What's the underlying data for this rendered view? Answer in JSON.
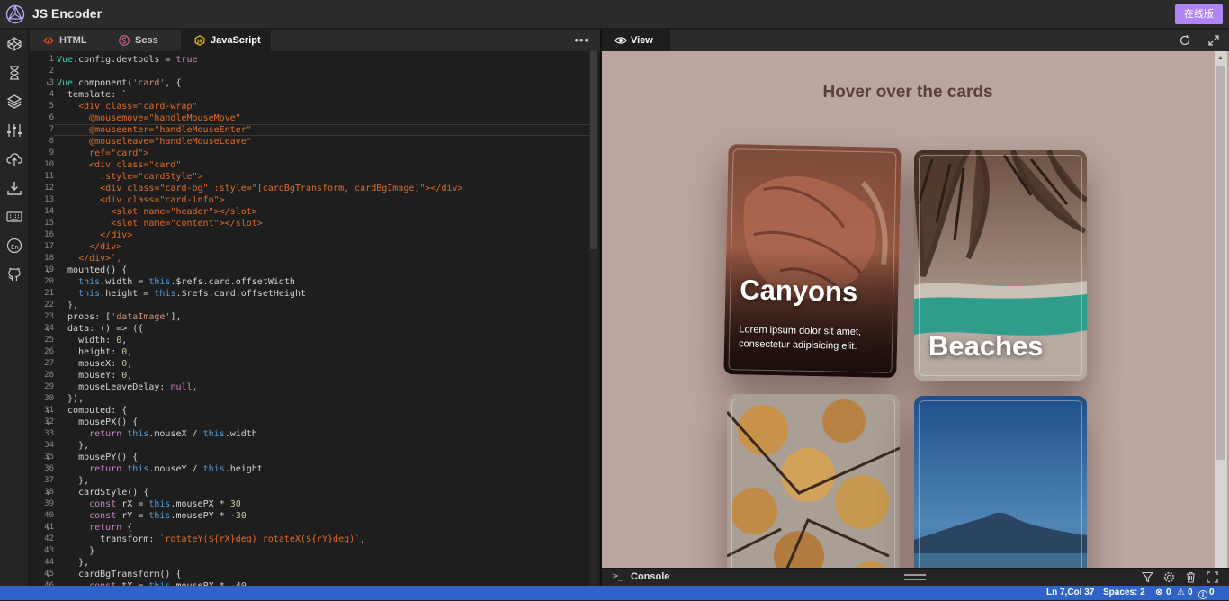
{
  "app": {
    "title": "JS Encoder",
    "online_button": "在线版"
  },
  "sidebar": {
    "icons": [
      "codepen-icon",
      "hourglass-icon",
      "layers-icon",
      "sliders-icon",
      "cloud-upload-icon",
      "download-icon",
      "keyboard-icon",
      "language-icon",
      "github-icon"
    ]
  },
  "editor": {
    "tabs": [
      {
        "label": "HTML",
        "icon": "html-icon",
        "color": "#e44d26"
      },
      {
        "label": "Scss",
        "icon": "sass-icon",
        "color": "#cd6799"
      },
      {
        "label": "JavaScript",
        "icon": "javascript-icon",
        "color": "#f0c020"
      }
    ],
    "more": "•••",
    "lines": [
      {
        "n": "1",
        "f": "",
        "t": "Vue.config.devtools = true"
      },
      {
        "n": "2",
        "f": "",
        "t": ""
      },
      {
        "n": "3",
        "f": "∨",
        "t": "Vue.component('card', {"
      },
      {
        "n": "4",
        "f": "",
        "t": "  template: `"
      },
      {
        "n": "5",
        "f": "",
        "t": "    <div class=\"card-wrap\""
      },
      {
        "n": "6",
        "f": "",
        "t": "      @mousemove=\"handleMouseMove\""
      },
      {
        "n": "7",
        "f": "",
        "t": "      @mouseenter=\"handleMouseEnter\""
      },
      {
        "n": "8",
        "f": "",
        "t": "      @mouseleave=\"handleMouseLeave\""
      },
      {
        "n": "9",
        "f": "",
        "t": "      ref=\"card\">"
      },
      {
        "n": "10",
        "f": "",
        "t": "      <div class=\"card\""
      },
      {
        "n": "11",
        "f": "",
        "t": "        :style=\"cardStyle\">"
      },
      {
        "n": "12",
        "f": "",
        "t": "        <div class=\"card-bg\" :style=\"[cardBgTransform, cardBgImage]\"></div>"
      },
      {
        "n": "13",
        "f": "",
        "t": "        <div class=\"card-info\">"
      },
      {
        "n": "14",
        "f": "",
        "t": "          <slot name=\"header\"></slot>"
      },
      {
        "n": "15",
        "f": "",
        "t": "          <slot name=\"content\"></slot>"
      },
      {
        "n": "16",
        "f": "",
        "t": "        </div>"
      },
      {
        "n": "17",
        "f": "",
        "t": "      </div>"
      },
      {
        "n": "18",
        "f": "",
        "t": "    </div>`,"
      },
      {
        "n": "19",
        "f": "∨",
        "t": "  mounted() {"
      },
      {
        "n": "20",
        "f": "",
        "t": "    this.width = this.$refs.card.offsetWidth"
      },
      {
        "n": "21",
        "f": "",
        "t": "    this.height = this.$refs.card.offsetHeight"
      },
      {
        "n": "22",
        "f": "",
        "t": "  },"
      },
      {
        "n": "23",
        "f": "",
        "t": "  props: ['dataImage'],"
      },
      {
        "n": "24",
        "f": "∨",
        "t": "  data: () => ({"
      },
      {
        "n": "25",
        "f": "",
        "t": "    width: 0,"
      },
      {
        "n": "26",
        "f": "",
        "t": "    height: 0,"
      },
      {
        "n": "27",
        "f": "",
        "t": "    mouseX: 0,"
      },
      {
        "n": "28",
        "f": "",
        "t": "    mouseY: 0,"
      },
      {
        "n": "29",
        "f": "",
        "t": "    mouseLeaveDelay: null,"
      },
      {
        "n": "30",
        "f": "",
        "t": "  }),"
      },
      {
        "n": "31",
        "f": "∨",
        "t": "  computed: {"
      },
      {
        "n": "32",
        "f": "∨",
        "t": "    mousePX() {"
      },
      {
        "n": "33",
        "f": "",
        "t": "      return this.mouseX / this.width"
      },
      {
        "n": "34",
        "f": "",
        "t": "    },"
      },
      {
        "n": "35",
        "f": "∨",
        "t": "    mousePY() {"
      },
      {
        "n": "36",
        "f": "",
        "t": "      return this.mouseY / this.height"
      },
      {
        "n": "37",
        "f": "",
        "t": "    },"
      },
      {
        "n": "38",
        "f": "∨",
        "t": "    cardStyle() {"
      },
      {
        "n": "39",
        "f": "",
        "t": "      const rX = this.mousePX * 30"
      },
      {
        "n": "40",
        "f": "",
        "t": "      const rY = this.mousePY * -30"
      },
      {
        "n": "41",
        "f": "∨",
        "t": "      return {"
      },
      {
        "n": "42",
        "f": "",
        "t": "        transform: `rotateY(${rX}deg) rotateX(${rY}deg)`,"
      },
      {
        "n": "43",
        "f": "",
        "t": "      }"
      },
      {
        "n": "44",
        "f": "",
        "t": "    },"
      },
      {
        "n": "45",
        "f": "∨",
        "t": "    cardBgTransform() {"
      },
      {
        "n": "46",
        "f": "",
        "t": "      const tX = this.mousePX * -40"
      }
    ],
    "line_colors": {
      "template": "#e06c2a",
      "default": "#d4d4d4",
      "teal": "#4ec9b0",
      "blue": "#569cd6",
      "string": "#ce9178",
      "number": "#b5cea8",
      "keyword": "#c586c0",
      "prop": "#9cdcfe",
      "ident": "#dcdcaa"
    }
  },
  "view": {
    "tab_label": "View",
    "headline": "Hover over the cards",
    "cards": [
      {
        "title": "Canyons",
        "text": "Lorem ipsum dolor sit amet, consectetur adipisicing elit."
      },
      {
        "title": "Beaches",
        "text": ""
      },
      {
        "title": "",
        "text": ""
      },
      {
        "title": "",
        "text": ""
      }
    ]
  },
  "console": {
    "label": "Console"
  },
  "status": {
    "position": "Ln 7,Col 37",
    "spaces": "Spaces: 2",
    "errors": "0",
    "warnings": "0",
    "infos": "0"
  },
  "colors": {
    "accent": "#b084f5",
    "statusbar": "#2f63c9",
    "preview_bg": "#baa59f"
  }
}
